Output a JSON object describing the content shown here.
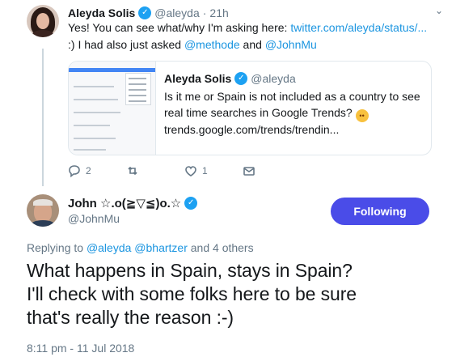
{
  "first_tweet": {
    "avatar_icon": "user-avatar-aleyda",
    "author_name": "Aleyda Solis",
    "author_handle": "@aleyda",
    "separator": "·",
    "time": "21h",
    "text_before_link": "Yes! You can see what/why I'm asking here: ",
    "link_text": "twitter.com/aleyda/status/...",
    "text_after_link": " :) I had also just asked ",
    "mention_1": "@methode",
    "text_and": " and ",
    "mention_2": "@JohnMu",
    "quoted": {
      "author_name": "Aleyda Solis",
      "author_handle": "@aleyda",
      "text": "Is it me or Spain is not included as a country to see real time searches in Google Trends?",
      "emoji": "flushed-face-emoji",
      "url": "trends.google.com/trends/trendin..."
    },
    "actions": {
      "reply_count": "2",
      "like_count": "1",
      "reply_icon": "reply-icon",
      "retweet_icon": "retweet-icon",
      "like_icon": "heart-icon",
      "dm_icon": "mail-icon"
    }
  },
  "main_tweet": {
    "avatar_icon": "user-avatar-johnmu",
    "author_name": "John ☆.o(≧▽≦)o.☆",
    "author_handle": "@JohnMu",
    "follow_label": "Following",
    "reply_prefix": "Replying to ",
    "reply_users": "@aleyda @bhartzer",
    "reply_suffix": " and 4 others",
    "text_line_1": "What happens in Spain, stays in Spain?",
    "text_line_2": "I'll check with some folks here to be sure",
    "text_line_3": "that's really the reason :-)",
    "timestamp": "8:11 pm - 11 Jul 2018"
  },
  "colors": {
    "link": "#1b95e0",
    "verified": "#1da1f2",
    "follow_button": "#4a4ce8",
    "secondary_text": "#657786"
  }
}
